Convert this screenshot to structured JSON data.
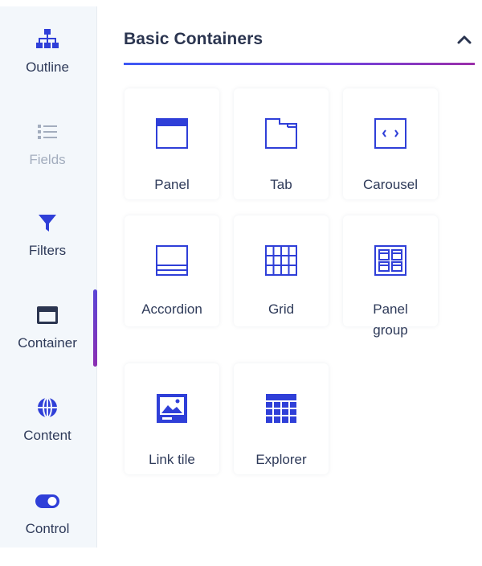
{
  "sidebar": {
    "items": [
      {
        "label": "Outline",
        "icon": "sitemap-icon",
        "state": "normal"
      },
      {
        "label": "Fields",
        "icon": "list-icon",
        "state": "disabled"
      },
      {
        "label": "Filters",
        "icon": "filter-icon",
        "state": "normal"
      },
      {
        "label": "Container",
        "icon": "container-icon",
        "state": "active"
      },
      {
        "label": "Content",
        "icon": "globe-icon",
        "state": "normal"
      },
      {
        "label": "Control",
        "icon": "toggle-icon",
        "state": "normal"
      }
    ]
  },
  "section": {
    "title": "Basic Containers",
    "collapsed": false,
    "tiles": [
      {
        "label": "Panel",
        "icon": "panel-icon"
      },
      {
        "label": "Tab",
        "icon": "tab-icon"
      },
      {
        "label": "Carousel",
        "icon": "carousel-icon"
      },
      {
        "label": "Accordion",
        "icon": "accordion-icon"
      },
      {
        "label": "Grid",
        "icon": "grid-icon"
      },
      {
        "label_line1": "Panel",
        "label_line2": "group",
        "icon": "panel-group-icon"
      },
      {
        "label": "Link tile",
        "icon": "link-tile-icon"
      },
      {
        "label": "Explorer",
        "icon": "explorer-icon"
      }
    ]
  },
  "colors": {
    "accent": "#2f3fd8",
    "icon_dark": "#2b3550",
    "sidebar_bg": "#f3f7fb",
    "gradient_start": "#3d59f5",
    "gradient_end": "#9b2fa9"
  }
}
